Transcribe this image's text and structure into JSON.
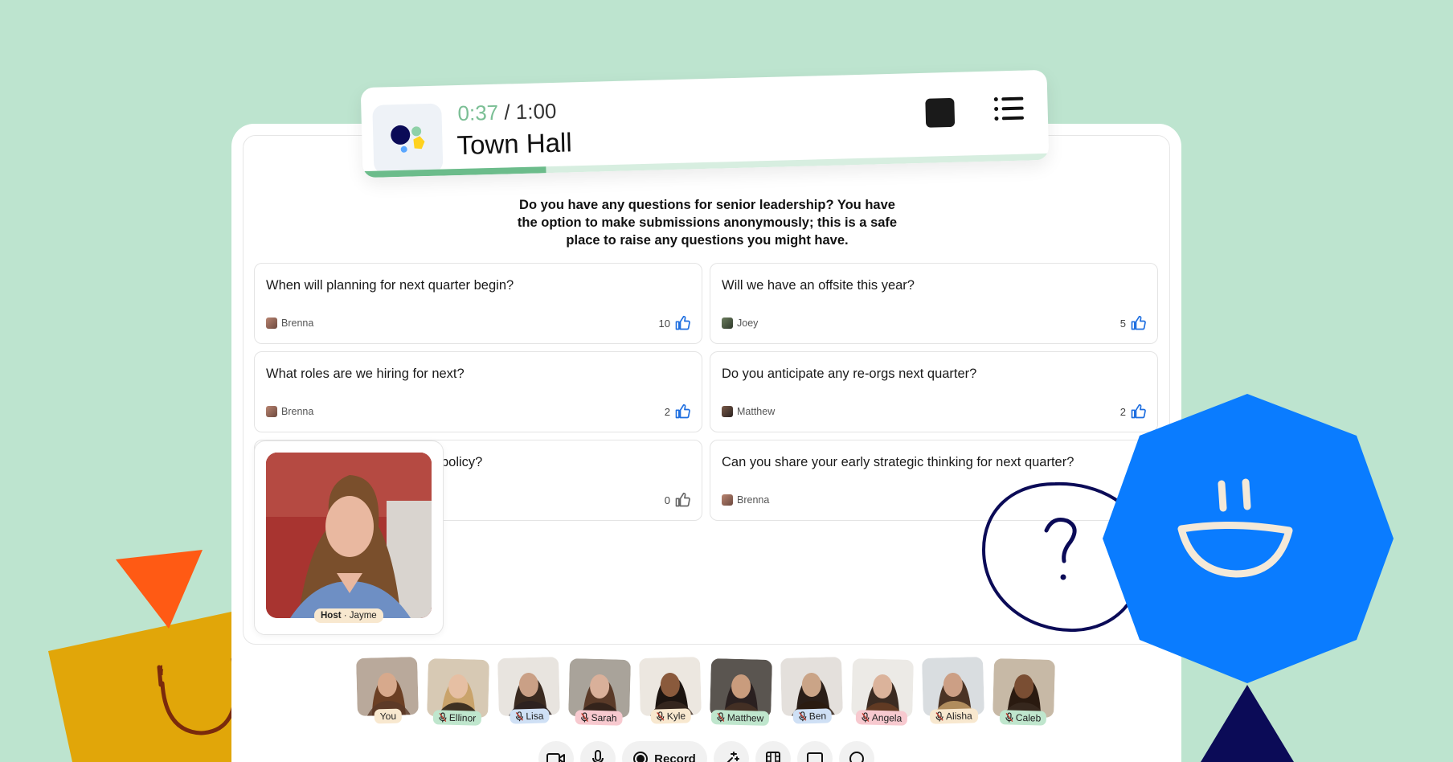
{
  "session": {
    "elapsed": "0:37",
    "separator": " / ",
    "duration": "1:00",
    "title": "Town Hall",
    "progress": 0.37
  },
  "prompt": "Do you have any questions for senior leadership? You have the option to make submissions anonymously; this is a safe place to raise any questions you might have.",
  "questions": [
    {
      "text": "When will planning for next quarter begin?",
      "author": "Brenna",
      "votes": "10",
      "voted": true
    },
    {
      "text": "Will we have an offsite this year?",
      "author": "Joey",
      "votes": "5",
      "voted": true
    },
    {
      "text": "What roles are we hiring for next?",
      "author": "Brenna",
      "votes": "2",
      "voted": true
    },
    {
      "text": "Do you anticipate any re-orgs next quarter?",
      "author": "Matthew",
      "votes": "2",
      "voted": true
    },
    {
      "text": "policy?",
      "author": "",
      "votes": "0",
      "voted": false
    },
    {
      "text": "Can you share your early strategic thinking for next quarter?",
      "author": "Brenna",
      "votes": "",
      "voted": false
    }
  ],
  "host": {
    "role": "Host",
    "separator": " · ",
    "name": "Jayme"
  },
  "participants": [
    {
      "name": "You",
      "muted": false,
      "badge_color": "#f8e8cf"
    },
    {
      "name": "Ellinor",
      "muted": true,
      "badge_color": "#bfe6cd"
    },
    {
      "name": "Lisa",
      "muted": true,
      "badge_color": "#cfe0f5"
    },
    {
      "name": "Sarah",
      "muted": true,
      "badge_color": "#f7c9cf"
    },
    {
      "name": "Kyle",
      "muted": true,
      "badge_color": "#f8e8cf"
    },
    {
      "name": "Matthew",
      "muted": true,
      "badge_color": "#bfe6cd"
    },
    {
      "name": "Ben",
      "muted": true,
      "badge_color": "#cfe0f5"
    },
    {
      "name": "Angela",
      "muted": true,
      "badge_color": "#f7c9cf"
    },
    {
      "name": "Alisha",
      "muted": true,
      "badge_color": "#f8e8cf"
    },
    {
      "name": "Caleb",
      "muted": true,
      "badge_color": "#bfe6cd"
    }
  ],
  "toolbar": {
    "record_label": "Record",
    "icons": [
      "camera-icon",
      "microphone-icon",
      "record-icon",
      "effects-icon",
      "film-icon",
      "screen-share-icon",
      "reaction-icon"
    ]
  },
  "colors": {
    "background": "#bde4cf",
    "accent": "#6cbc8b",
    "like_blue": "#1f6fe0",
    "deco_blue": "#0a7cff",
    "deco_orange": "#ff5a14",
    "deco_yellow": "#e1a609",
    "deco_navy": "#0b0b57"
  }
}
